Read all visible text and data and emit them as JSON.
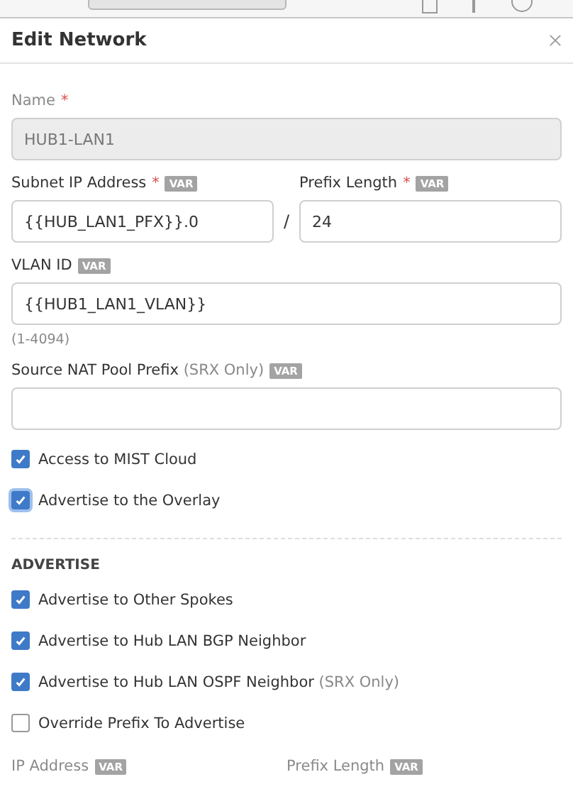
{
  "panel": {
    "title": "Edit Network"
  },
  "fields": [
    {
      "kind": "single",
      "label": "Name",
      "required_mark": "*",
      "disabled": true,
      "value": "HUB1-LAN1"
    },
    {
      "kind": "pair",
      "left": {
        "label": "Subnet IP Address",
        "required_mark": "*",
        "var": "VAR",
        "value": "{{HUB_LAN1_PFX}}.0"
      },
      "separator": "/",
      "right": {
        "label": "Prefix Length",
        "required_mark": "*",
        "var": "VAR",
        "value": "24"
      }
    },
    {
      "kind": "single",
      "label": "VLAN ID",
      "disabled": false,
      "var": "VAR",
      "value": "{{HUB1_LAN1_VLAN}}",
      "hint": "(1-4094)"
    },
    {
      "kind": "single",
      "label": "Source NAT Pool Prefix",
      "note": "(SRX Only)",
      "disabled": false,
      "var": "VAR"
    }
  ],
  "options": [
    {
      "label": "Access to MIST Cloud",
      "checked": true,
      "focused": false
    },
    {
      "label": "Advertise to the Overlay",
      "checked": true,
      "focused": true
    }
  ],
  "advertise": {
    "heading": "ADVERTISE",
    "options": [
      {
        "label": "Advertise to Other Spokes",
        "checked": true
      },
      {
        "label": "Advertise to Hub LAN BGP Neighbor",
        "checked": true
      },
      {
        "label": "Advertise to Hub LAN OSPF Neighbor",
        "note": "(SRX Only)",
        "checked": true
      },
      {
        "label": "Override Prefix To Advertise",
        "checked": false
      }
    ],
    "labels": [
      {
        "label": "IP Address",
        "var": "VAR",
        "disabled": true
      },
      {
        "label": "Prefix Length",
        "var": "VAR",
        "disabled": true
      }
    ]
  }
}
